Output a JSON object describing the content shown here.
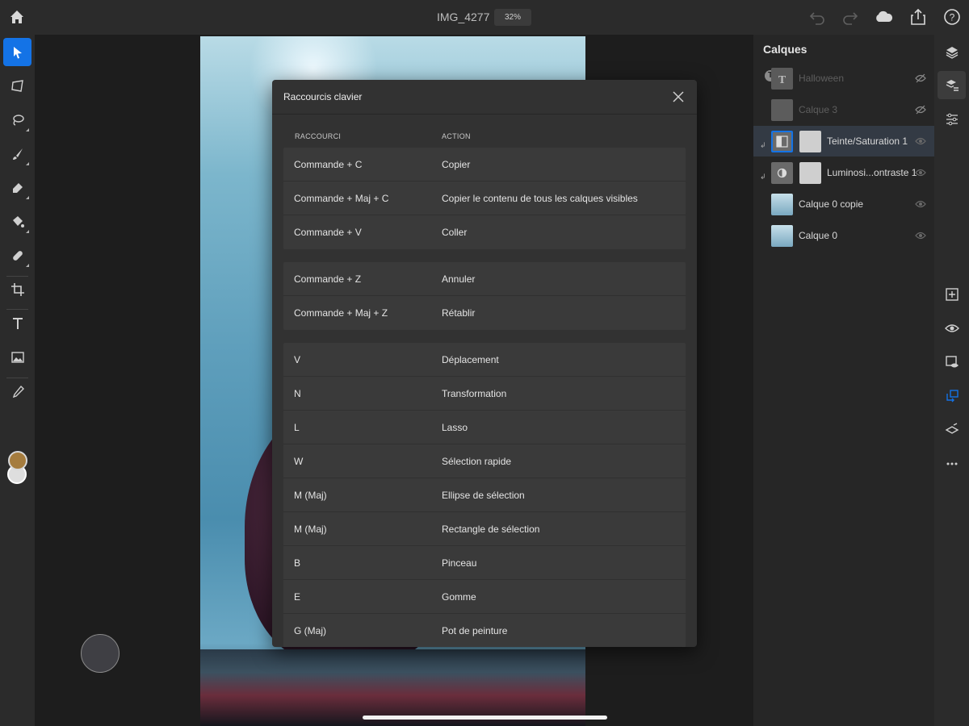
{
  "header": {
    "document_title": "IMG_4277",
    "zoom": "32%"
  },
  "layers_panel": {
    "title": "Calques",
    "layers": [
      {
        "name": "Halloween",
        "type": "text",
        "visible": false
      },
      {
        "name": "Calque 3",
        "type": "pixel",
        "visible": false
      },
      {
        "name": "Teinte/Saturation 1",
        "type": "adjustment",
        "visible": true,
        "selected": true
      },
      {
        "name": "Luminosi...ontraste 1",
        "type": "adjustment",
        "visible": true
      },
      {
        "name": "Calque 0 copie",
        "type": "pixel",
        "visible": true
      },
      {
        "name": "Calque 0",
        "type": "pixel",
        "visible": true
      }
    ],
    "text_badge": "T"
  },
  "modal": {
    "title": "Raccourcis clavier",
    "col_shortcut": "RACCOURCI",
    "col_action": "ACTION",
    "groups": [
      [
        {
          "key": "Commande + C",
          "action": "Copier"
        },
        {
          "key": "Commande + Maj + C",
          "action": "Copier le contenu de tous les calques visibles"
        },
        {
          "key": "Commande + V",
          "action": "Coller"
        }
      ],
      [
        {
          "key": "Commande + Z",
          "action": "Annuler"
        },
        {
          "key": "Commande + Maj + Z",
          "action": "Rétablir"
        }
      ],
      [
        {
          "key": "V",
          "action": "Déplacement"
        },
        {
          "key": "N",
          "action": "Transformation"
        },
        {
          "key": "L",
          "action": "Lasso"
        },
        {
          "key": "W",
          "action": "Sélection rapide"
        },
        {
          "key": "M (Maj)",
          "action": "Ellipse de sélection"
        },
        {
          "key": "M (Maj)",
          "action": "Rectangle de sélection"
        },
        {
          "key": "B",
          "action": "Pinceau"
        },
        {
          "key": "E",
          "action": "Gomme"
        },
        {
          "key": "G (Maj)",
          "action": "Pot de peinture"
        }
      ]
    ]
  },
  "colors": {
    "accent": "#1473e6",
    "foreground_color": "#a57c3e",
    "background_color": "#dedede"
  }
}
